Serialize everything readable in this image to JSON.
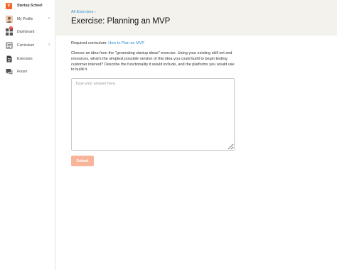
{
  "sidebar": {
    "brand": {
      "logo_letter": "Y",
      "name": "Startup School"
    },
    "items": [
      {
        "label": "My Profile",
        "icon": "profile-icon",
        "has_chevron": true
      },
      {
        "label": "Dashboard",
        "icon": "dashboard-icon",
        "badge": "4"
      },
      {
        "label": "Curriculum",
        "icon": "curriculum-icon",
        "has_chevron": true
      },
      {
        "label": "Exercises",
        "icon": "exercises-icon",
        "active": true
      },
      {
        "label": "Forum",
        "icon": "forum-icon"
      }
    ],
    "chevron": "›"
  },
  "breadcrumb": {
    "link": "All Exercises",
    "separator": "›"
  },
  "page": {
    "title": "Exercise: Planning an MVP",
    "required_label": "Required curriculum:",
    "required_link": "How to Plan an MVP",
    "prompt": "Choose an idea from the \"generating startup ideas\" exercise. Using your existing skill set and resources, what's the simplest possible version of this idea you could build to begin testing customer interest? Describe the functionality it would include, and the platforms you would use to build it.",
    "answer_placeholder": "Type your answer here.",
    "answer_value": "",
    "submit_label": "Submit"
  },
  "colors": {
    "brand_orange": "#f26625",
    "link_blue": "#2f8fd1",
    "header_band": "#f3f2ec",
    "submit_disabled": "#f8b59a",
    "badge_red": "#e0312f"
  }
}
